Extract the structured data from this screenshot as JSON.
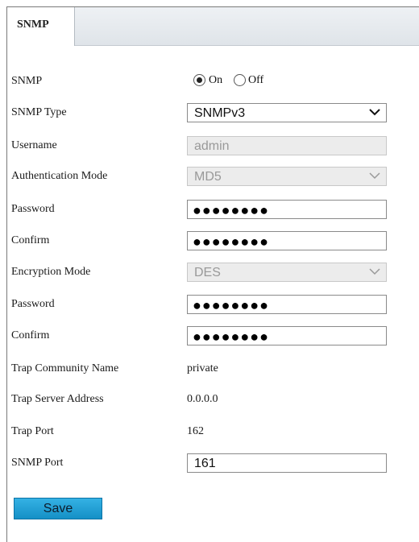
{
  "tab": {
    "label": "SNMP"
  },
  "form": {
    "snmp": {
      "label": "SNMP",
      "on_label": "On",
      "off_label": "Off",
      "selected": "On"
    },
    "snmp_type": {
      "label": "SNMP Type",
      "value": "SNMPv3"
    },
    "username": {
      "label": "Username",
      "value": "admin"
    },
    "auth_mode": {
      "label": "Authentication Mode",
      "value": "MD5"
    },
    "auth_password": {
      "label": "Password",
      "value": "●●●●●●●●"
    },
    "auth_confirm": {
      "label": "Confirm",
      "value": "●●●●●●●●"
    },
    "enc_mode": {
      "label": "Encryption Mode",
      "value": "DES"
    },
    "enc_password": {
      "label": "Password",
      "value": "●●●●●●●●"
    },
    "enc_confirm": {
      "label": "Confirm",
      "value": "●●●●●●●●"
    },
    "trap_community": {
      "label": "Trap Community Name",
      "value": "private"
    },
    "trap_server": {
      "label": "Trap Server Address",
      "value": "0.0.0.0"
    },
    "trap_port": {
      "label": "Trap Port",
      "value": "162"
    },
    "snmp_port": {
      "label": "SNMP Port",
      "value": "161"
    }
  },
  "buttons": {
    "save": "Save"
  },
  "icons": {
    "dropdown": "chevron-down-icon"
  },
  "colors": {
    "save_button": "#1fa2d8",
    "tab_bar": "#e4e8ec"
  }
}
